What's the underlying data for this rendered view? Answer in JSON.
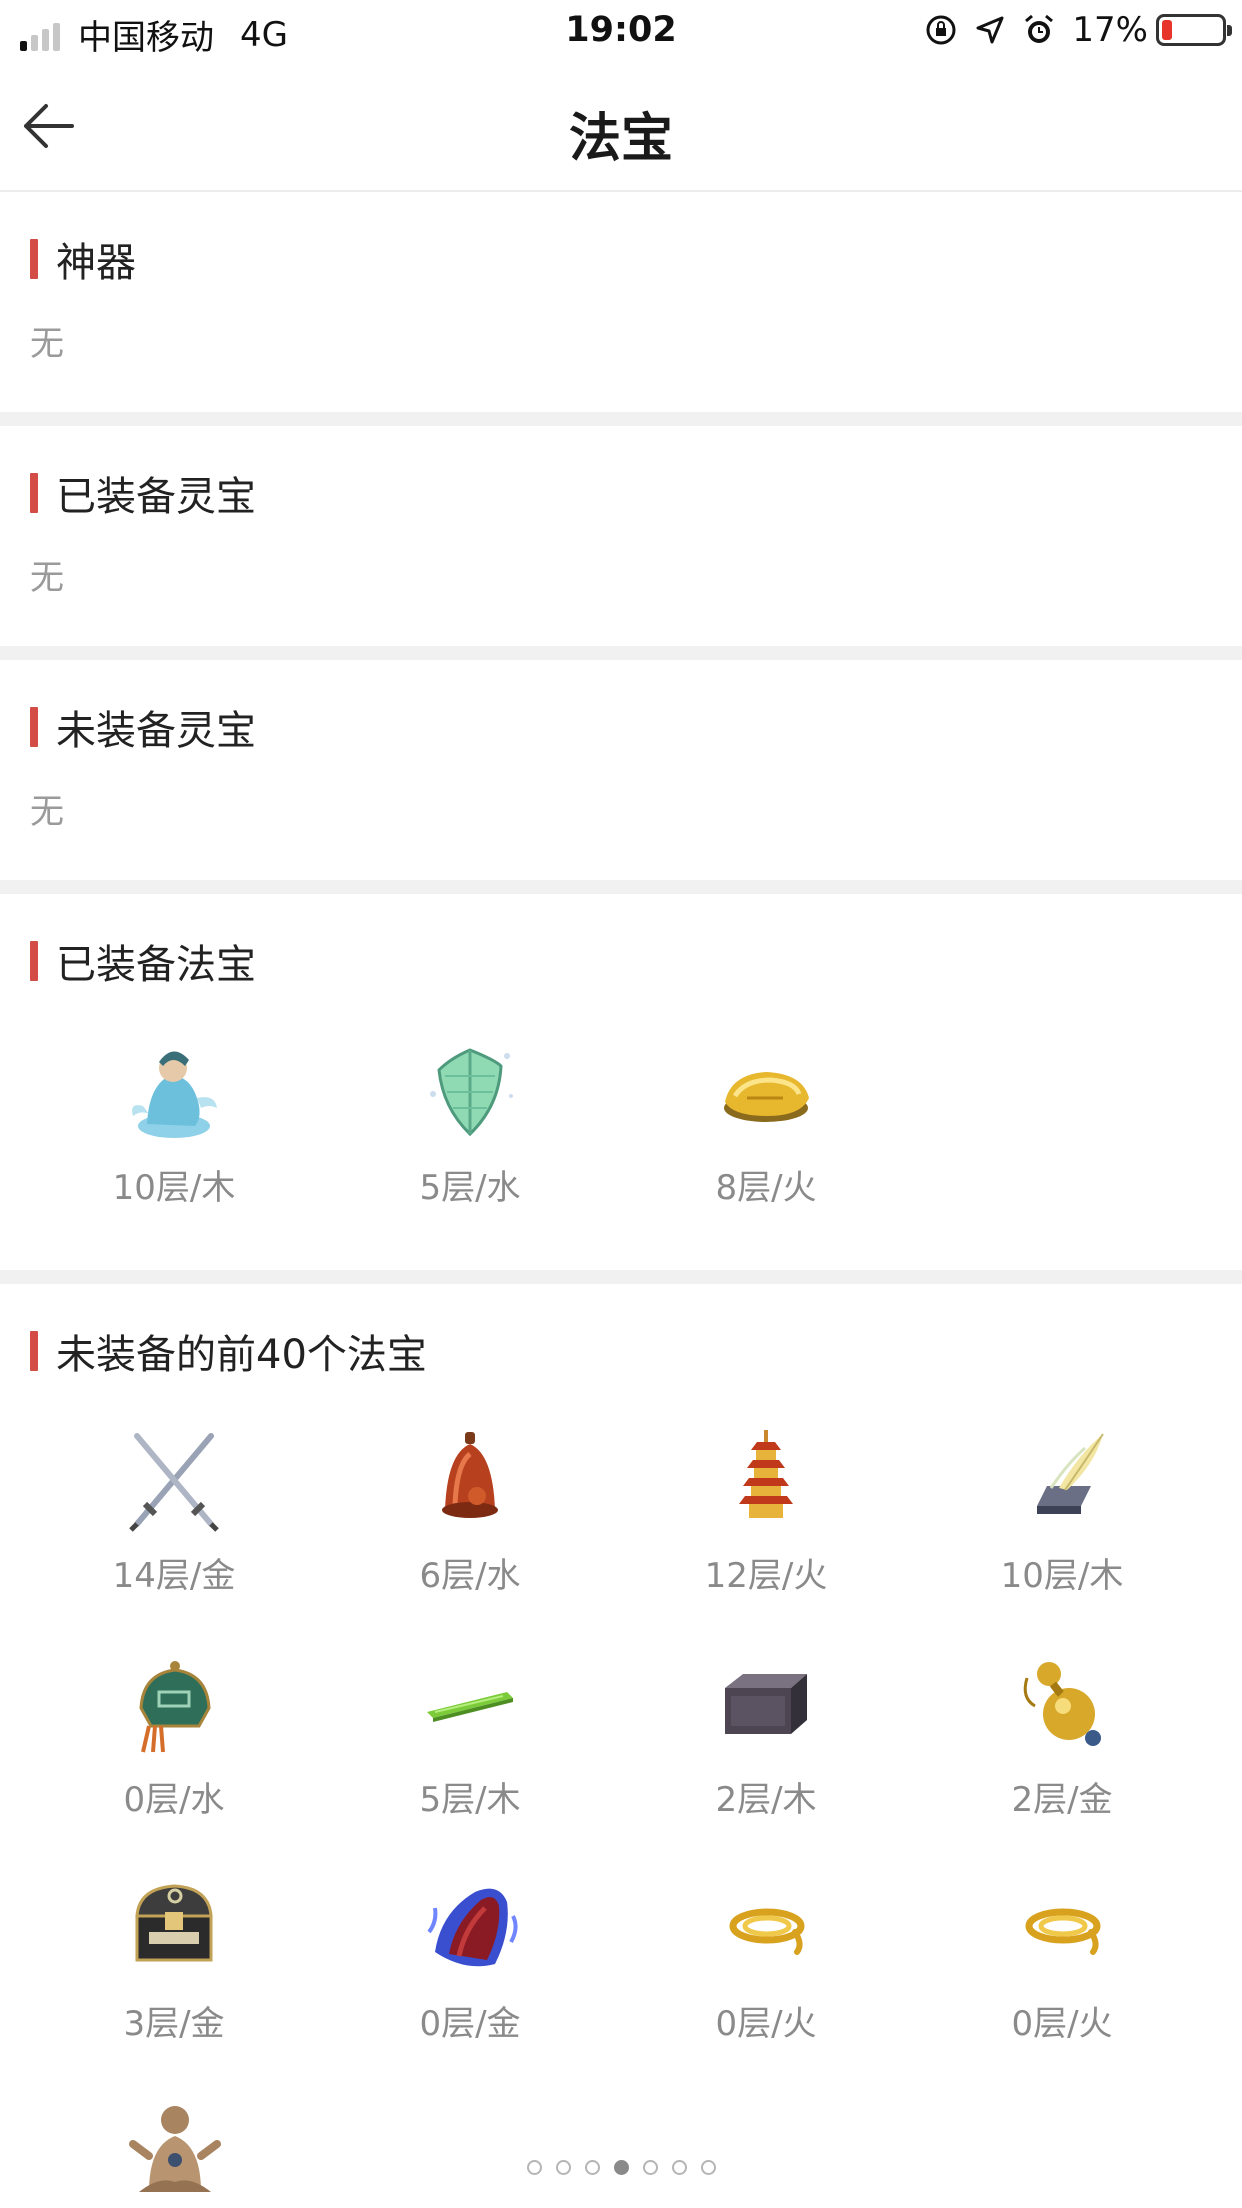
{
  "status_bar": {
    "carrier": "中国移动",
    "network": "4G",
    "time": "19:02",
    "battery": "17%",
    "battery_level": 0.17,
    "signal_bars": 1
  },
  "nav": {
    "title": "法宝",
    "back_icon": "arrow-left-icon"
  },
  "sections": {
    "shenqi": {
      "title": "神器",
      "empty_text": "无"
    },
    "equipped_lingbao": {
      "title": "已装备灵宝",
      "empty_text": "无"
    },
    "unequipped_lingbao": {
      "title": "未装备灵宝",
      "empty_text": "无"
    },
    "equipped_fabao": {
      "title": "已装备法宝",
      "items": [
        {
          "label": "10层/木",
          "icon": "jade-spirit-figure-icon"
        },
        {
          "label": "5层/水",
          "icon": "jade-shield-icon"
        },
        {
          "label": "8层/火",
          "icon": "gold-ingot-icon"
        }
      ]
    },
    "unequipped_fabao": {
      "title": "未装备的前40个法宝",
      "items": [
        {
          "label": "14层/金",
          "icon": "crossed-swords-icon"
        },
        {
          "label": "6层/水",
          "icon": "bell-icon"
        },
        {
          "label": "12层/火",
          "icon": "pagoda-icon"
        },
        {
          "label": "10层/木",
          "icon": "feather-box-icon"
        },
        {
          "label": "0层/水",
          "icon": "jade-pendant-icon"
        },
        {
          "label": "5层/木",
          "icon": "green-bar-icon"
        },
        {
          "label": "2层/木",
          "icon": "dark-chest-icon"
        },
        {
          "label": "2层/金",
          "icon": "gourd-icon"
        },
        {
          "label": "3层/金",
          "icon": "treasure-chest-icon"
        },
        {
          "label": "0层/金",
          "icon": "flame-cloth-icon"
        },
        {
          "label": "0层/火",
          "icon": "golden-rope-icon"
        },
        {
          "label": "0层/火",
          "icon": "golden-rope-icon"
        },
        {
          "label": "",
          "icon": "sitting-figure-icon"
        }
      ]
    }
  },
  "pager": {
    "count": 7,
    "active": 3
  }
}
